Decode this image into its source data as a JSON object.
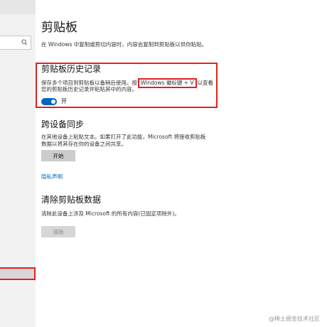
{
  "page": {
    "title": "剪贴板",
    "description": "在 Windows 中复制或剪切内容时，内容会复制到剪贴板以供你粘贴。"
  },
  "history": {
    "heading": "剪贴板历史记录",
    "line1_pre": "保存多个项目到剪贴板以备稍后使用。按",
    "hotkey": "Windows 徽标键 + V",
    "line1_post": "以查看",
    "line2": "您的剪贴板历史记录并粘贴其中的内容。",
    "toggle_label": "开",
    "toggle_on": true
  },
  "sync": {
    "heading": "跨设备同步",
    "line1": "在其他设备上粘贴文本。如果打开了此功能，Microsoft 将接收剪贴板",
    "line2": "数据以将其存在你的设备之间共享。",
    "button": "开始"
  },
  "privacy": {
    "link": "隐私声明"
  },
  "clear": {
    "heading": "清除剪贴板数据",
    "description": "清除此设备上涉及 Microsoft 的所有内容(已固定项除外)。",
    "button": "清除"
  },
  "watermark": "@稀土掘金技术社区",
  "colors": {
    "accent": "#0067c0",
    "highlight": "#e32020"
  }
}
